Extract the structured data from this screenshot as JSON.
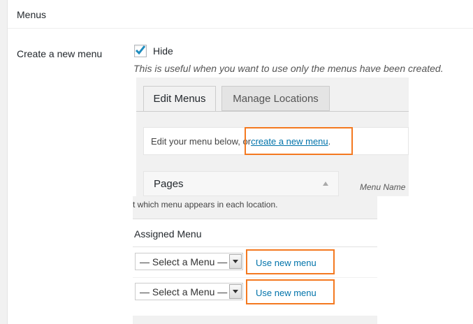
{
  "section": {
    "title": "Menus",
    "row_label": "Create a new menu",
    "checkbox_label": "Hide",
    "checkbox_checked": true,
    "hint": "This is useful when you want to use only the menus have been created."
  },
  "screenshot": {
    "tabs": [
      {
        "label": "Edit Menus",
        "active": true
      },
      {
        "label": "Manage Locations",
        "active": false
      }
    ],
    "notice_prefix": "Edit your menu below, or ",
    "notice_link": "create a new menu",
    "notice_suffix": ".",
    "pages_label": "Pages",
    "menu_name_col": "Menu Name"
  },
  "locations": {
    "cropped_text": "t which menu appears in each location.",
    "column_header": "Assigned Menu",
    "rows": [
      {
        "select_value": "— Select a Menu —",
        "link": "Use new menu"
      },
      {
        "select_value": "— Select a Menu —",
        "link": "Use new menu"
      }
    ]
  },
  "colors": {
    "highlight": "#f47920",
    "link": "#0073aa",
    "checkmark": "#1e8cbe"
  }
}
